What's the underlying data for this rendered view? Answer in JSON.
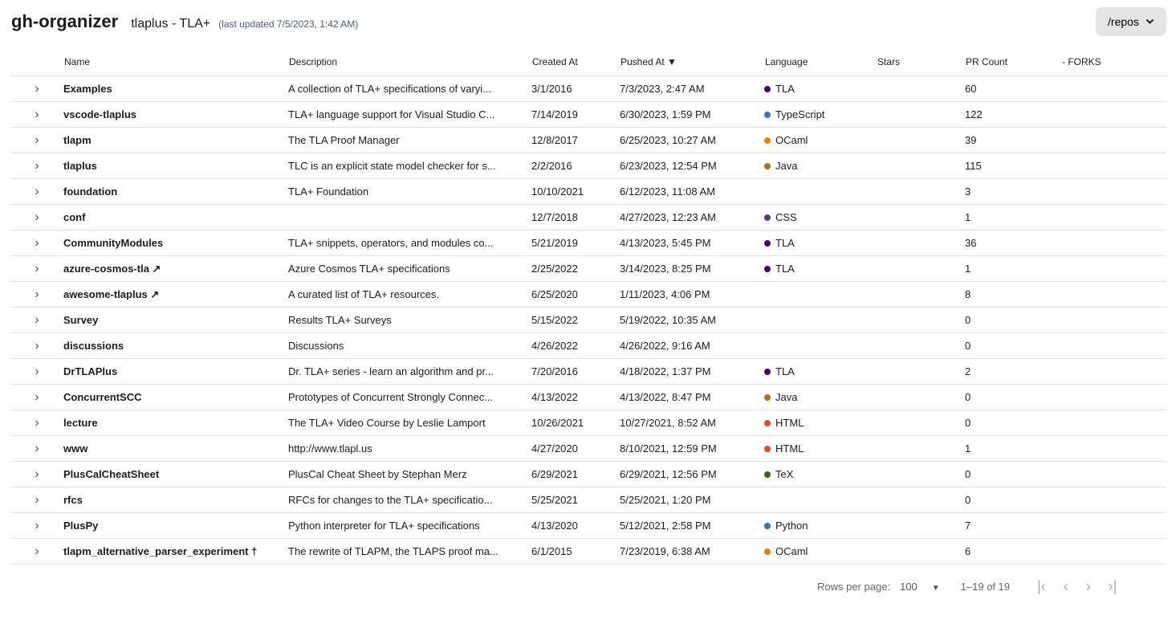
{
  "header": {
    "title": "gh-organizer",
    "org": "tlaplus - TLA+",
    "updated": "(last updated 7/5/2023, 1:42 AM)",
    "repos_button": "/repos"
  },
  "columns": {
    "name": "Name",
    "description": "Description",
    "created": "Created At",
    "pushed": "Pushed At ▼",
    "language": "Language",
    "stars": "Stars",
    "pr": "PR Count",
    "forks": "- FORKS"
  },
  "lang_colors": {
    "TLA": "#4b0079",
    "TypeScript": "#3178c6",
    "OCaml": "#ef7a08",
    "Java": "#b07219",
    "CSS": "#563d7c",
    "HTML": "#e34c26",
    "TeX": "#3d6117",
    "Python": "#3572a5"
  },
  "rows": [
    {
      "name": "Examples",
      "desc": "A collection of TLA+ specifications of varyi...",
      "created": "3/1/2016",
      "pushed": "7/3/2023, 2:47 AM",
      "lang": "TLA",
      "stars": "",
      "pr": "60"
    },
    {
      "name": "vscode-tlaplus",
      "desc": "TLA+ language support for Visual Studio C...",
      "created": "7/14/2019",
      "pushed": "6/30/2023, 1:59 PM",
      "lang": "TypeScript",
      "stars": "",
      "pr": "122"
    },
    {
      "name": "tlapm",
      "desc": "The TLA Proof Manager",
      "created": "12/8/2017",
      "pushed": "6/25/2023, 10:27 AM",
      "lang": "OCaml",
      "stars": "",
      "pr": "39"
    },
    {
      "name": "tlaplus",
      "desc": "TLC is an explicit state model checker for s...",
      "created": "2/2/2016",
      "pushed": "6/23/2023, 12:54 PM",
      "lang": "Java",
      "stars": "",
      "pr": "115"
    },
    {
      "name": "foundation",
      "desc": "TLA+ Foundation",
      "created": "10/10/2021",
      "pushed": "6/12/2023, 11:08 AM",
      "lang": "",
      "stars": "",
      "pr": "3"
    },
    {
      "name": "conf",
      "desc": "",
      "created": "12/7/2018",
      "pushed": "4/27/2023, 12:23 AM",
      "lang": "CSS",
      "stars": "",
      "pr": "1"
    },
    {
      "name": "CommunityModules",
      "desc": "TLA+ snippets, operators, and modules co...",
      "created": "5/21/2019",
      "pushed": "4/13/2023, 5:45 PM",
      "lang": "TLA",
      "stars": "",
      "pr": "36"
    },
    {
      "name": "azure-cosmos-tla ↗",
      "desc": "Azure Cosmos TLA+ specifications",
      "created": "2/25/2022",
      "pushed": "3/14/2023, 8:25 PM",
      "lang": "TLA",
      "stars": "",
      "pr": "1"
    },
    {
      "name": "awesome-tlaplus ↗",
      "desc": "A curated list of TLA+ resources.",
      "created": "6/25/2020",
      "pushed": "1/11/2023, 4:06 PM",
      "lang": "",
      "stars": "",
      "pr": "8"
    },
    {
      "name": "Survey",
      "desc": "Results TLA+ Surveys",
      "created": "5/15/2022",
      "pushed": "5/19/2022, 10:35 AM",
      "lang": "",
      "stars": "",
      "pr": "0"
    },
    {
      "name": "discussions",
      "desc": "Discussions",
      "created": "4/26/2022",
      "pushed": "4/26/2022, 9:16 AM",
      "lang": "",
      "stars": "",
      "pr": "0"
    },
    {
      "name": "DrTLAPlus",
      "desc": "Dr. TLA+ series - learn an algorithm and pr...",
      "created": "7/20/2016",
      "pushed": "4/18/2022, 1:37 PM",
      "lang": "TLA",
      "stars": "",
      "pr": "2"
    },
    {
      "name": "ConcurrentSCC",
      "desc": "Prototypes of Concurrent Strongly Connec...",
      "created": "4/13/2022",
      "pushed": "4/13/2022, 8:47 PM",
      "lang": "Java",
      "stars": "",
      "pr": "0"
    },
    {
      "name": "lecture",
      "desc": "The TLA+ Video Course by Leslie Lamport",
      "created": "10/26/2021",
      "pushed": "10/27/2021, 8:52 AM",
      "lang": "HTML",
      "stars": "",
      "pr": "0"
    },
    {
      "name": "www",
      "desc": "http://www.tlapl.us",
      "created": "4/27/2020",
      "pushed": "8/10/2021, 12:59 PM",
      "lang": "HTML",
      "stars": "",
      "pr": "1"
    },
    {
      "name": "PlusCalCheatSheet",
      "desc": "PlusCal Cheat Sheet by Stephan Merz",
      "created": "6/29/2021",
      "pushed": "6/29/2021, 12:56 PM",
      "lang": "TeX",
      "stars": "",
      "pr": "0"
    },
    {
      "name": "rfcs",
      "desc": "RFCs for changes to the TLA+ specificatio...",
      "created": "5/25/2021",
      "pushed": "5/25/2021, 1:20 PM",
      "lang": "",
      "stars": "",
      "pr": "0"
    },
    {
      "name": "PlusPy",
      "desc": "Python interpreter for TLA+ specifications",
      "created": "4/13/2020",
      "pushed": "5/12/2021, 2:58 PM",
      "lang": "Python",
      "stars": "",
      "pr": "7"
    },
    {
      "name": "tlapm_alternative_parser_experiment †",
      "desc": "The rewrite of TLAPM, the TLAPS proof ma...",
      "created": "6/1/2015",
      "pushed": "7/23/2019, 6:38 AM",
      "lang": "OCaml",
      "stars": "",
      "pr": "6"
    }
  ],
  "pager": {
    "rows_label": "Rows per page:",
    "rows_value": "100",
    "range": "1–19 of 19"
  }
}
